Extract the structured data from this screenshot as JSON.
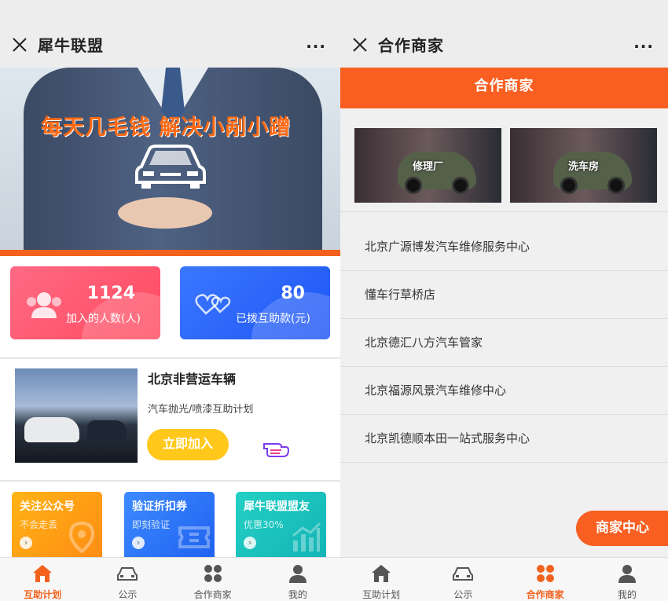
{
  "left": {
    "title": "犀牛联盟",
    "more": "···",
    "banner_text": "每天几毛钱 解决小剐小蹭",
    "stats": [
      {
        "value": "1124",
        "label": "加入的人数(人)",
        "color": "#ff5a6e"
      },
      {
        "value": "80",
        "label": "已拨互助款(元)",
        "color": "#2a63f8"
      }
    ],
    "feature": {
      "title": "北京非营运车辆",
      "subtitle": "汽车抛光/喷漆互助计划",
      "button": "立即加入"
    },
    "tiles": [
      {
        "title": "关注公众号",
        "subtitle": "不会走丢",
        "icon": "location-icon"
      },
      {
        "title": "验证折扣券",
        "subtitle": "即刻验证",
        "icon": "ticket-icon"
      },
      {
        "title": "犀牛联盟盟友",
        "subtitle": "优惠30%",
        "icon": "bar-chart-icon"
      }
    ],
    "tabs": [
      {
        "label": "互助计划",
        "active": true,
        "icon": "home-icon"
      },
      {
        "label": "公示",
        "active": false,
        "icon": "car-icon"
      },
      {
        "label": "合作商家",
        "active": false,
        "icon": "grid-icon"
      },
      {
        "label": "我的",
        "active": false,
        "icon": "user-icon"
      }
    ]
  },
  "right": {
    "title": "合作商家",
    "more": "···",
    "header": "合作商家",
    "categories": [
      "修理厂",
      "洗车房"
    ],
    "merchants": [
      "北京广源博发汽车维修服务中心",
      "懂车行草桥店",
      "北京德汇八方汽车管家",
      "北京福源风景汽车维修中心",
      "北京凯德顺本田一站式服务中心"
    ],
    "merchant_center": "商家中心",
    "tabs": [
      {
        "label": "互助计划",
        "active": false,
        "icon": "home-icon"
      },
      {
        "label": "公示",
        "active": false,
        "icon": "car-icon"
      },
      {
        "label": "合作商家",
        "active": true,
        "icon": "grid-icon"
      },
      {
        "label": "我的",
        "active": false,
        "icon": "user-icon"
      }
    ]
  },
  "colors": {
    "accent": "#f85f21",
    "yellow": "#ffc81b"
  }
}
